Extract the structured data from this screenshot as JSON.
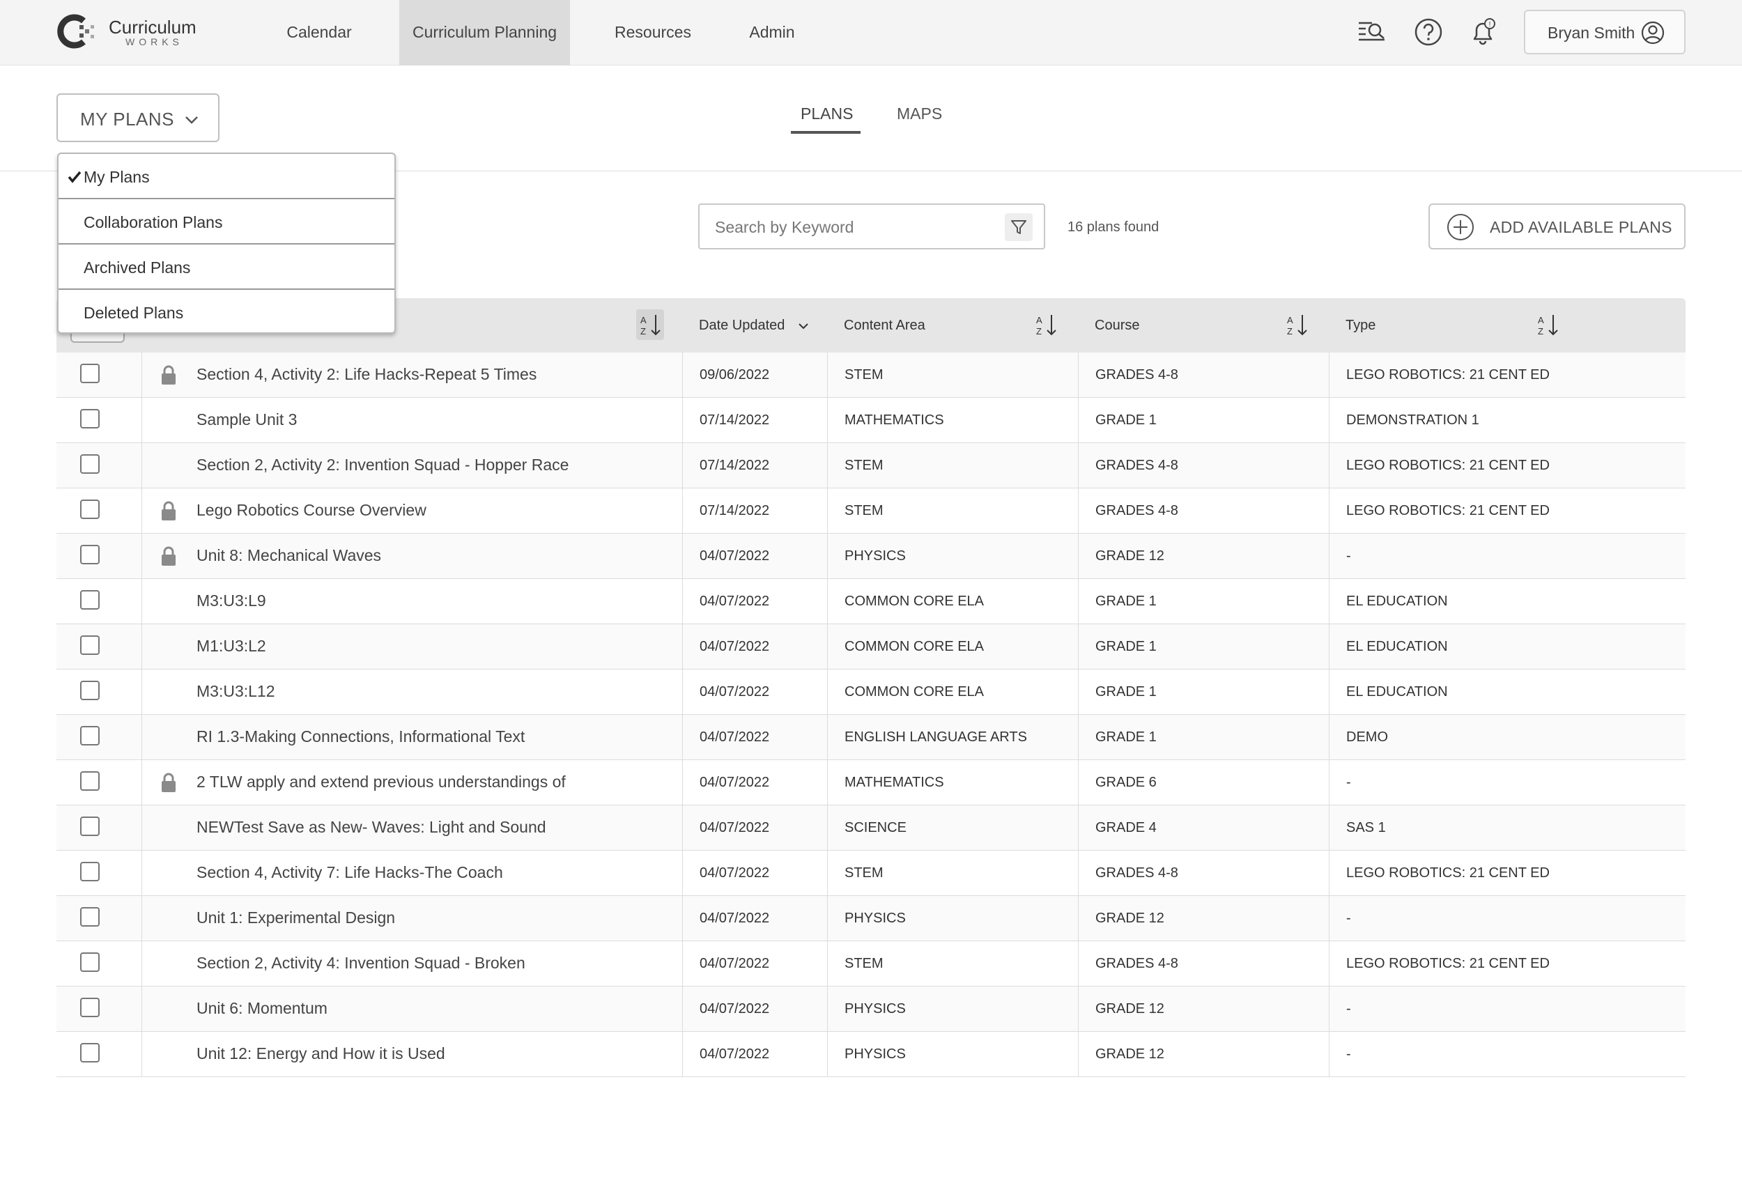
{
  "brand": {
    "name": "Curriculum",
    "sub": "WORKS"
  },
  "nav": {
    "items": [
      {
        "label": "Calendar",
        "active": false
      },
      {
        "label": "Curriculum Planning",
        "active": true
      },
      {
        "label": "Resources",
        "active": false
      },
      {
        "label": "Admin",
        "active": false
      }
    ]
  },
  "header_icons": [
    "search-list-icon",
    "help-icon",
    "notification-bell-icon"
  ],
  "user": {
    "name": "Bryan Smith"
  },
  "plans_select": {
    "label": "MY PLANS"
  },
  "view_tabs": [
    {
      "label": "PLANS",
      "active": true
    },
    {
      "label": "MAPS",
      "active": false
    }
  ],
  "search": {
    "placeholder": "Search by Keyword"
  },
  "found": "16 plans found",
  "add_button": {
    "label": "ADD AVAILABLE PLANS"
  },
  "menu": {
    "items": [
      {
        "label": "My Plans",
        "selected": true
      },
      {
        "label": "Collaboration Plans",
        "selected": false
      },
      {
        "label": "Archived Plans",
        "selected": false
      },
      {
        "label": "Deleted Plans",
        "selected": false
      }
    ]
  },
  "table": {
    "columns": {
      "date": "Date Updated",
      "content": "Content Area",
      "course": "Course",
      "type": "Type"
    },
    "rows": [
      {
        "title": "Section 4, Activity 2: Life Hacks-Repeat 5 Times",
        "locked": true,
        "date": "09/06/2022",
        "content": "STEM",
        "course": "GRADES 4-8",
        "type": "LEGO ROBOTICS: 21 CENT ED"
      },
      {
        "title": "Sample Unit 3",
        "locked": false,
        "date": "07/14/2022",
        "content": "MATHEMATICS",
        "course": "GRADE 1",
        "type": "DEMONSTRATION 1"
      },
      {
        "title": "Section 2, Activity 2: Invention Squad - Hopper Race",
        "locked": false,
        "date": "07/14/2022",
        "content": "STEM",
        "course": "GRADES 4-8",
        "type": "LEGO ROBOTICS: 21 CENT ED"
      },
      {
        "title": "Lego Robotics Course Overview",
        "locked": true,
        "date": "07/14/2022",
        "content": "STEM",
        "course": "GRADES 4-8",
        "type": "LEGO ROBOTICS: 21 CENT ED"
      },
      {
        "title": "Unit 8: Mechanical Waves",
        "locked": true,
        "date": "04/07/2022",
        "content": "PHYSICS",
        "course": "GRADE 12",
        "type": "-"
      },
      {
        "title": "M3:U3:L9",
        "locked": false,
        "date": "04/07/2022",
        "content": "COMMON CORE ELA",
        "course": "GRADE 1",
        "type": "EL EDUCATION"
      },
      {
        "title": "M1:U3:L2",
        "locked": false,
        "date": "04/07/2022",
        "content": "COMMON CORE ELA",
        "course": "GRADE 1",
        "type": "EL EDUCATION"
      },
      {
        "title": "M3:U3:L12",
        "locked": false,
        "date": "04/07/2022",
        "content": "COMMON CORE ELA",
        "course": "GRADE 1",
        "type": "EL EDUCATION"
      },
      {
        "title": "RI 1.3-Making Connections, Informational Text",
        "locked": false,
        "date": "04/07/2022",
        "content": "ENGLISH LANGUAGE ARTS",
        "course": "GRADE 1",
        "type": "DEMO"
      },
      {
        "title": "2 TLW apply and extend previous understandings of",
        "locked": true,
        "date": "04/07/2022",
        "content": "MATHEMATICS",
        "course": "GRADE 6",
        "type": "-"
      },
      {
        "title": "NEWTest Save as New- Waves: Light and Sound",
        "locked": false,
        "date": "04/07/2022",
        "content": "SCIENCE",
        "course": "GRADE 4",
        "type": "SAS 1"
      },
      {
        "title": "Section 4, Activity 7: Life Hacks-The Coach",
        "locked": false,
        "date": "04/07/2022",
        "content": "STEM",
        "course": "GRADES 4-8",
        "type": "LEGO ROBOTICS: 21 CENT ED"
      },
      {
        "title": "Unit 1: Experimental Design",
        "locked": false,
        "date": "04/07/2022",
        "content": "PHYSICS",
        "course": "GRADE 12",
        "type": "-"
      },
      {
        "title": "Section 2, Activity 4: Invention Squad - Broken",
        "locked": false,
        "date": "04/07/2022",
        "content": "STEM",
        "course": "GRADES 4-8",
        "type": "LEGO ROBOTICS: 21 CENT ED"
      },
      {
        "title": "Unit 6: Momentum",
        "locked": false,
        "date": "04/07/2022",
        "content": "PHYSICS",
        "course": "GRADE 12",
        "type": "-"
      },
      {
        "title": "Unit 12: Energy and How it is Used",
        "locked": false,
        "date": "04/07/2022",
        "content": "PHYSICS",
        "course": "GRADE 12",
        "type": "-"
      }
    ]
  }
}
